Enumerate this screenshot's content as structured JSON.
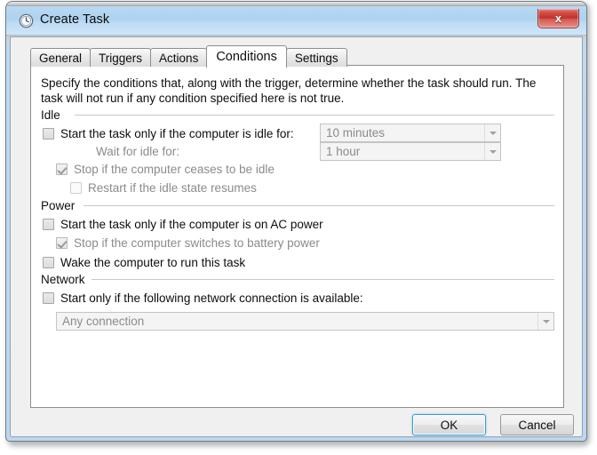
{
  "window": {
    "title": "Create Task",
    "icon": "clock-icon",
    "close_label": "x"
  },
  "tabs": [
    {
      "label": "General",
      "selected": false
    },
    {
      "label": "Triggers",
      "selected": false
    },
    {
      "label": "Actions",
      "selected": false
    },
    {
      "label": "Conditions",
      "selected": true
    },
    {
      "label": "Settings",
      "selected": false
    }
  ],
  "page": {
    "description": "Specify the conditions that, along with the trigger, determine whether the task should run.  The task will not run  if any condition specified here is not true.",
    "groups": {
      "idle": {
        "label": "Idle",
        "start_when_idle": {
          "label": "Start the task only if the computer is idle for:",
          "checked": false,
          "value": "10 minutes"
        },
        "wait_for_idle": {
          "label": "Wait for idle for:",
          "value": "1 hour"
        },
        "stop_if_ceases_idle": {
          "label": "Stop if the computer ceases to be idle",
          "checked": true
        },
        "restart_if_idle_resumes": {
          "label": "Restart if the idle state resumes",
          "checked": false
        }
      },
      "power": {
        "label": "Power",
        "only_on_ac": {
          "label": "Start the task only if the computer is on AC power",
          "checked": false
        },
        "stop_on_battery": {
          "label": "Stop if the computer switches to battery power",
          "checked": true
        },
        "wake_computer": {
          "label": "Wake the computer to run this task",
          "checked": false
        }
      },
      "network": {
        "label": "Network",
        "only_if_network": {
          "label": "Start only if the following network connection is available:",
          "checked": false
        },
        "connection": {
          "value": "Any connection"
        }
      }
    }
  },
  "footer": {
    "ok_label": "OK",
    "cancel_label": "Cancel"
  },
  "colors": {
    "caption": "#aed2ef",
    "close_red": "#bf2f28",
    "default_focus": "#3c9ad6",
    "page_bg": "#ffffff",
    "dialog_bg": "#f0f0f0"
  }
}
